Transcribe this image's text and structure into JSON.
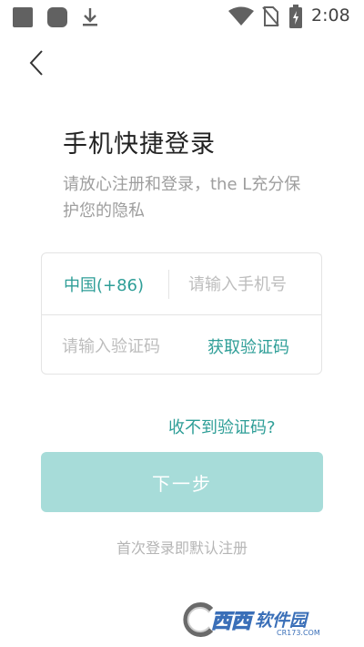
{
  "status_bar": {
    "time": "2:08",
    "icons": [
      "app-icon",
      "app-icon",
      "download-icon",
      "wifi-icon",
      "no-sim-icon",
      "battery-charging-icon"
    ]
  },
  "header": {
    "back_icon": "chevron-left-icon"
  },
  "page": {
    "title": "手机快捷登录",
    "subtitle": "请放心注册和登录，the L充分保护您的隐私"
  },
  "form": {
    "country_code": "中国(+86)",
    "phone_placeholder": "请输入手机号",
    "phone_value": "",
    "code_placeholder": "请输入验证码",
    "code_value": "",
    "get_code_label": "获取验证码"
  },
  "links": {
    "no_code": "收不到验证码?"
  },
  "actions": {
    "next_label": "下一步"
  },
  "footer": {
    "note": "首次登录即默认注册"
  },
  "watermark": {
    "text_main": "西西",
    "text_sub": "软件园",
    "url": "CR173.COM"
  },
  "colors": {
    "accent": "#2e9e97",
    "button_disabled": "#a7dcd9",
    "muted_text": "#9e9e9e",
    "border": "#e4e4e4"
  }
}
